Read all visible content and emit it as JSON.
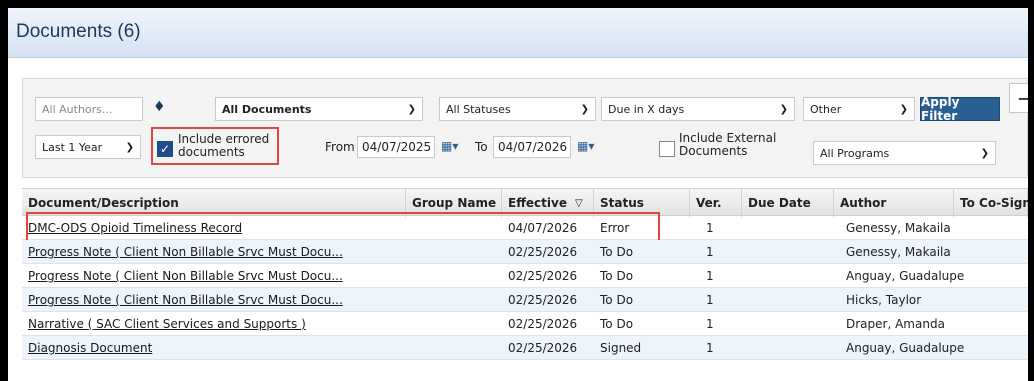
{
  "title": "Documents (6)",
  "filters": {
    "authors_placeholder": "All Authors...",
    "documents_select": "All Documents",
    "statuses_select": "All Statuses",
    "due_select": "Due in X days",
    "other_select": "Other",
    "apply_label": "Apply Filter",
    "collapse_label": "−",
    "period_select": "Last 1 Year",
    "include_errored_label": "Include errored documents",
    "include_errored_checked": true,
    "from_label": "From",
    "from_date": "04/07/2025",
    "to_label": "To",
    "to_date": "04/07/2026",
    "include_external_label": "Include External Documents",
    "include_external_checked": false,
    "programs_select": "All Programs"
  },
  "grid": {
    "columns": [
      "Document/Description",
      "Group Name",
      "Effective",
      "Status",
      "Ver.",
      "Due Date",
      "Author",
      "To Co-Sign"
    ],
    "rows": [
      {
        "doc": "DMC-ODS Opioid Timeliness Record",
        "group": "",
        "effective": "04/07/2026",
        "status": "Error",
        "ver": "1",
        "due": "",
        "author": "Genessy, Makaila",
        "cosign": ""
      },
      {
        "doc": "Progress Note ( Client Non Billable Srvc Must Docu...",
        "group": "",
        "effective": "02/25/2026",
        "status": "To Do",
        "ver": "1",
        "due": "",
        "author": "Genessy, Makaila",
        "cosign": ""
      },
      {
        "doc": "Progress Note ( Client Non Billable Srvc Must Docu...",
        "group": "",
        "effective": "02/25/2026",
        "status": "To Do",
        "ver": "1",
        "due": "",
        "author": "Anguay, Guadalupe",
        "cosign": ""
      },
      {
        "doc": "Progress Note ( Client Non Billable Srvc Must Docu...",
        "group": "",
        "effective": "02/25/2026",
        "status": "To Do",
        "ver": "1",
        "due": "",
        "author": "Hicks, Taylor",
        "cosign": ""
      },
      {
        "doc": "Narrative ( SAC Client Services and Supports )",
        "group": "",
        "effective": "02/25/2026",
        "status": "To Do",
        "ver": "1",
        "due": "",
        "author": "Draper, Amanda",
        "cosign": ""
      },
      {
        "doc": "Diagnosis Document",
        "group": "",
        "effective": "02/25/2026",
        "status": "Signed",
        "ver": "1",
        "due": "",
        "author": "Anguay, Guadalupe",
        "cosign": ""
      }
    ]
  },
  "colors": {
    "accent": "#2a5f94",
    "highlight": "#e2453a",
    "alt_row": "#eef4fb"
  }
}
